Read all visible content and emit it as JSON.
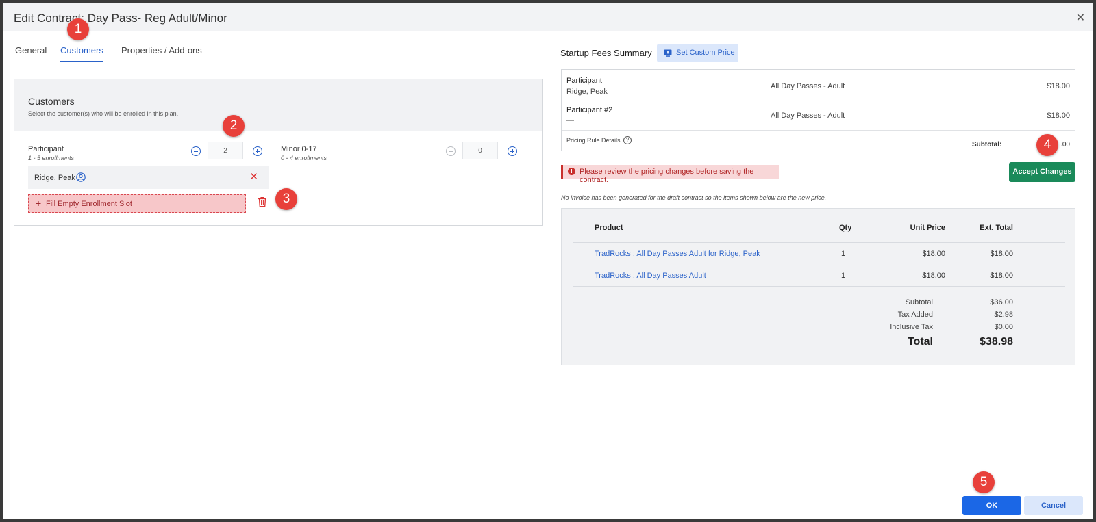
{
  "dialog": {
    "title": "Edit Contract: Day Pass- Reg Adult/Minor",
    "close_label": "✕"
  },
  "tabs": [
    {
      "label": "General",
      "active": false
    },
    {
      "label": "Customers",
      "active": true
    },
    {
      "label": "Properties / Add-ons",
      "active": false
    }
  ],
  "customers": {
    "title": "Customers",
    "subtitle": "Select the customer(s) who will be enrolled in this plan.",
    "groups": [
      {
        "label": "Participant",
        "range": "1 - 5 enrollments",
        "count": "2"
      },
      {
        "label": "Minor 0-17",
        "range": "0 - 4 enrollments",
        "count": "0"
      }
    ],
    "enrolled": [
      {
        "name": "Ridge, Peak"
      }
    ],
    "fill_slot_label": "Fill Empty Enrollment Slot"
  },
  "summary": {
    "title": "Startup Fees Summary",
    "custom_price_label": "Set Custom Price",
    "lines": [
      {
        "name": "Participant",
        "customer": "Ridge, Peak",
        "item": "All Day Passes - Adult",
        "amount": "$18.00"
      },
      {
        "name": "Participant #2",
        "customer": "—",
        "item": "All Day Passes - Adult",
        "amount": "$18.00"
      }
    ],
    "pricing_rule_label": "Pricing Rule Details",
    "subtotal_label": "Subtotal:",
    "subtotal_value": ".00"
  },
  "warning": {
    "text": "Please review the pricing changes before saving the contract.",
    "accept_label": "Accept Changes"
  },
  "invoice": {
    "note": "No invoice has been generated for the draft contract so the items shown below are the new price.",
    "headers": {
      "product": "Product",
      "qty": "Qty",
      "unit": "Unit Price",
      "ext": "Ext. Total"
    },
    "rows": [
      {
        "product": "TradRocks : All Day Passes Adult for Ridge, Peak",
        "qty": "1",
        "unit": "$18.00",
        "ext": "$18.00"
      },
      {
        "product": "TradRocks : All Day Passes Adult",
        "qty": "1",
        "unit": "$18.00",
        "ext": "$18.00"
      }
    ],
    "totals": [
      {
        "label": "Subtotal",
        "value": "$36.00"
      },
      {
        "label": "Tax Added",
        "value": "$2.98"
      },
      {
        "label": "Inclusive Tax",
        "value": "$0.00"
      }
    ],
    "total_label": "Total",
    "total_value": "$38.98"
  },
  "footer": {
    "ok_label": "OK",
    "cancel_label": "Cancel"
  },
  "markers": [
    "1",
    "2",
    "3",
    "4",
    "5"
  ],
  "colors": {
    "accent": "#2a62c9",
    "accept": "#1a8a5a",
    "ok": "#1b67e6",
    "warning": "#c9302c",
    "marker": "#e8403a"
  }
}
